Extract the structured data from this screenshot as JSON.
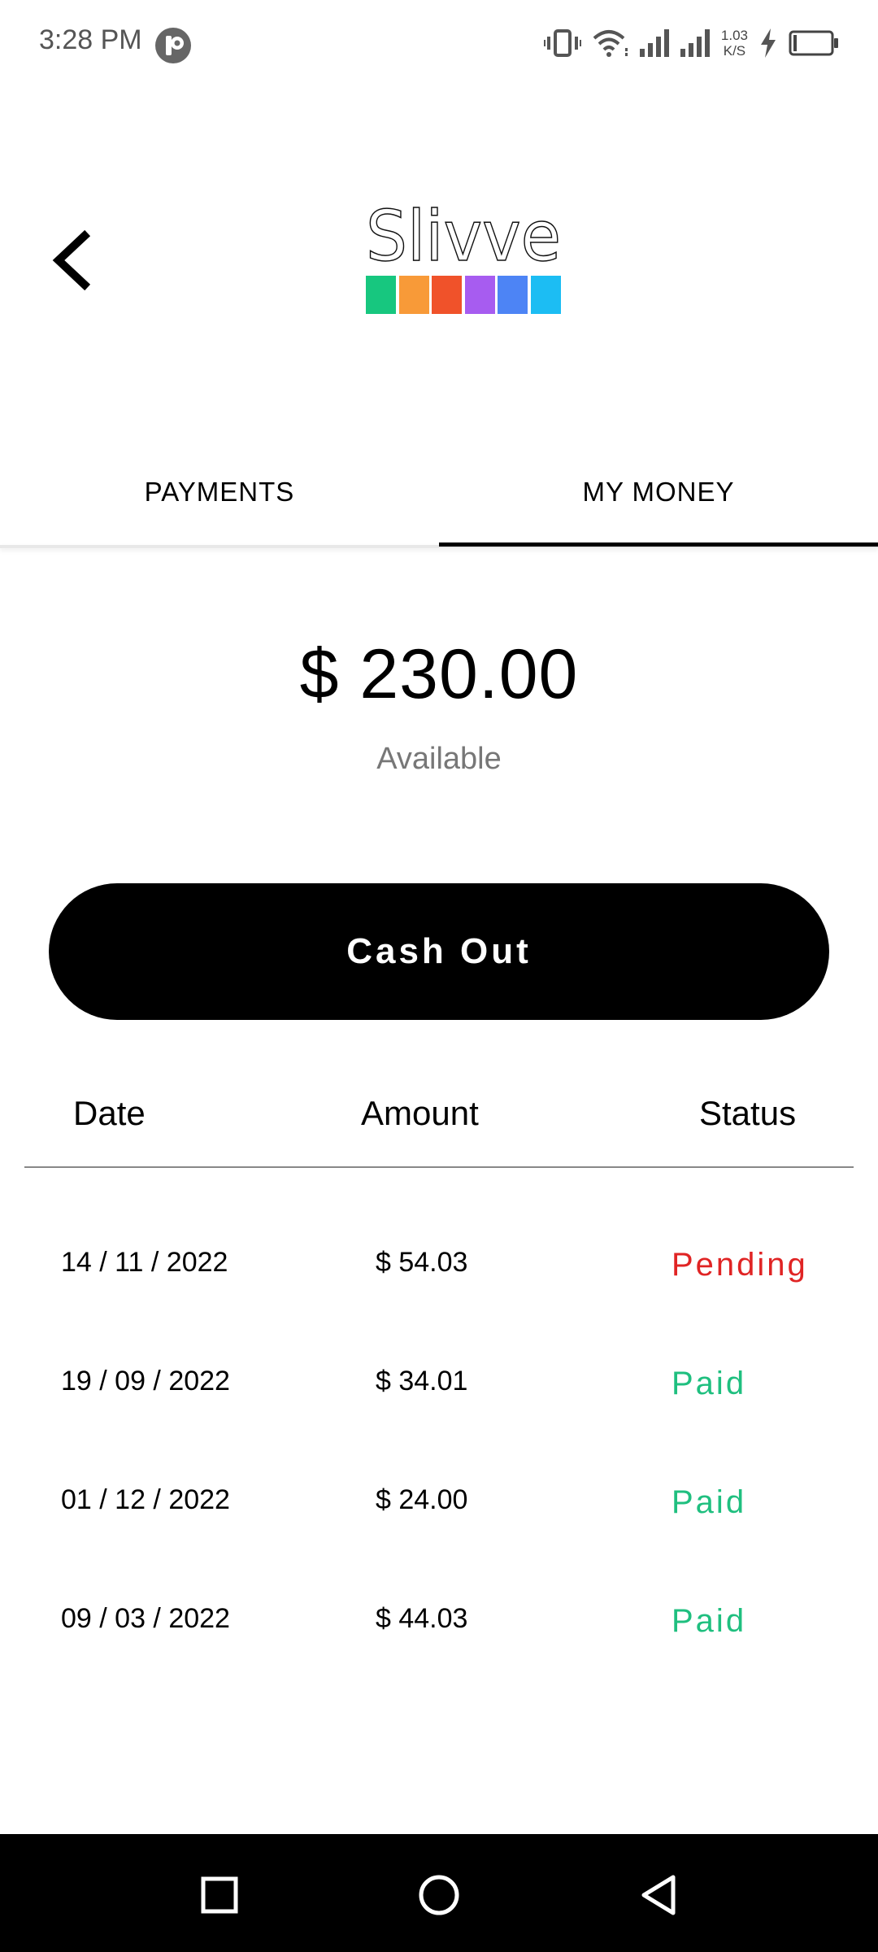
{
  "status_bar": {
    "time": "3:28 PM",
    "net_speed_value": "1.03",
    "net_speed_unit": "K/S",
    "icons": [
      "vibrate-icon",
      "wifi-icon",
      "signal-icon",
      "signal-icon",
      "charging-icon",
      "battery-icon"
    ]
  },
  "header": {
    "logo_text": "Slivve",
    "logo_colors": [
      "#17c77f",
      "#f89a38",
      "#f0522a",
      "#a75cf0",
      "#4d84f5",
      "#1cbdf3"
    ]
  },
  "tabs": [
    {
      "label": "PAYMENTS",
      "active": false
    },
    {
      "label": "MY MONEY",
      "active": true
    }
  ],
  "balance": {
    "amount": "$ 230.00",
    "label": "Available"
  },
  "cashout": {
    "label": "Cash Out"
  },
  "table": {
    "headers": {
      "date": "Date",
      "amount": "Amount",
      "status": "Status"
    },
    "rows": [
      {
        "date": "14 / 11 / 2022",
        "amount": "$ 54.03",
        "status": "Pending",
        "status_color": "#e02424"
      },
      {
        "date": "19 / 09 / 2022",
        "amount": "$ 34.01",
        "status": "Paid",
        "status_color": "#1fbf7f"
      },
      {
        "date": "01 / 12 / 2022",
        "amount": "$ 24.00",
        "status": "Paid",
        "status_color": "#1fbf7f"
      },
      {
        "date": "09 / 03 / 2022",
        "amount": "$ 44.03",
        "status": "Paid",
        "status_color": "#1fbf7f"
      }
    ]
  },
  "nav_bar": {
    "buttons": [
      "recents-icon",
      "home-icon",
      "back-icon"
    ]
  }
}
